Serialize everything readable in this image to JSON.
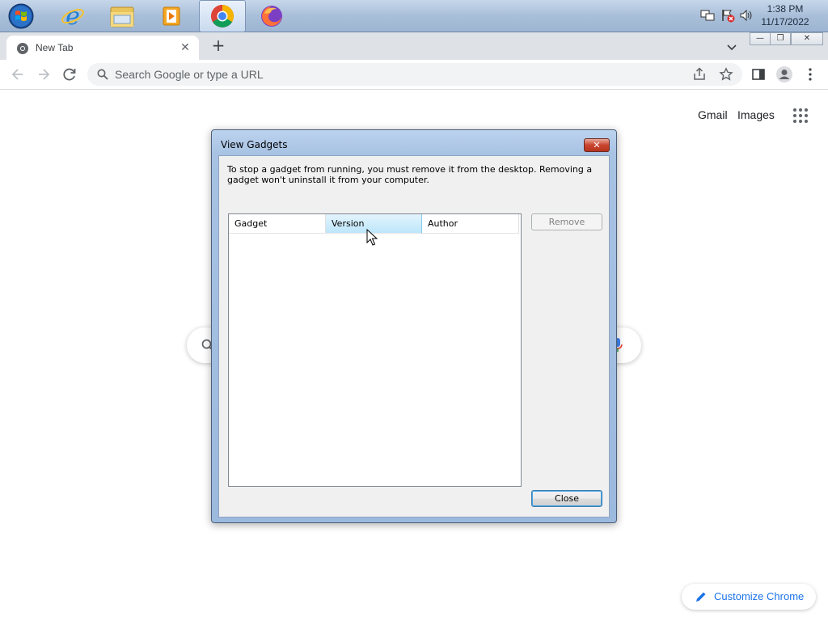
{
  "taskbar": {
    "apps": [
      {
        "name": "Internet Explorer",
        "icon": "internet-explorer-icon"
      },
      {
        "name": "File Explorer",
        "icon": "folder-icon"
      },
      {
        "name": "Media Player",
        "icon": "media-player-icon"
      },
      {
        "name": "Google Chrome",
        "icon": "chrome-icon",
        "active": true
      },
      {
        "name": "Firefox",
        "icon": "firefox-icon"
      }
    ],
    "clock": {
      "time": "1:38 PM",
      "date": "11/17/2022"
    }
  },
  "browser": {
    "tab": {
      "title": "New Tab"
    },
    "omnibox": {
      "placeholder": "Search Google or type a URL"
    }
  },
  "ntp": {
    "gmail": "Gmail",
    "images": "Images",
    "customize": "Customize Chrome"
  },
  "dialog": {
    "title": "View Gadgets",
    "close_glyph": "✕",
    "message": "To stop a gadget from running, you must remove it from the desktop. Removing a gadget won't uninstall it from your computer.",
    "columns": [
      "Gadget",
      "Version",
      "Author"
    ],
    "rows": [],
    "remove_label": "Remove",
    "close_label": "Close"
  }
}
